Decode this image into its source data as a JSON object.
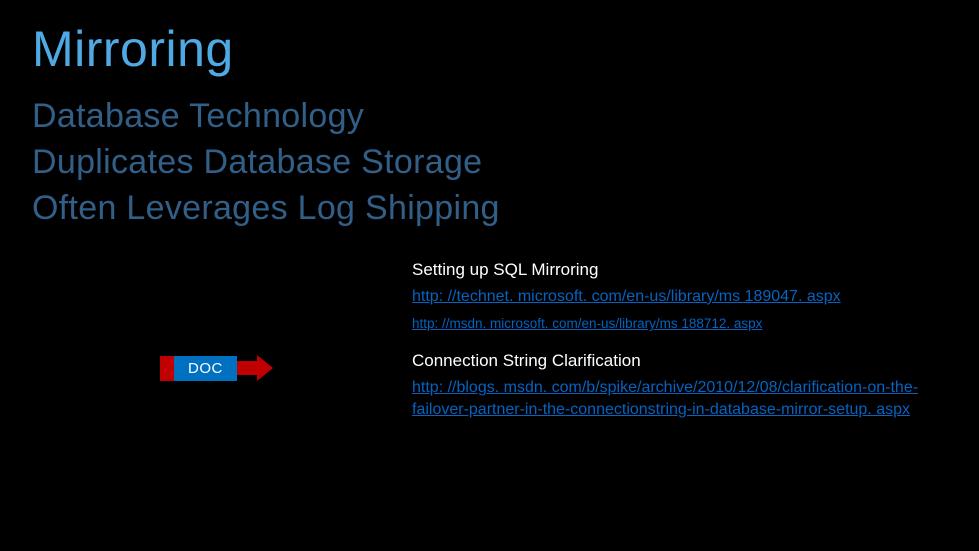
{
  "title": "Mirroring",
  "subtitles": {
    "line1": "Database Technology",
    "line2": "Duplicates Database Storage",
    "line3": "Often Leverages Log Shipping"
  },
  "doc_badge": {
    "label": "DOC"
  },
  "sections": {
    "section1": {
      "heading": "Setting up SQL Mirroring",
      "link1": "http: //technet. microsoft. com/en-us/library/ms 189047. aspx",
      "link2": "http: //msdn. microsoft. com/en-us/library/ms 188712. aspx"
    },
    "section2": {
      "heading": "Connection String Clarification",
      "link1": "http: //blogs. msdn. com/b/spike/archive/2010/12/08/clarification-on-the-failover-partner-in-the-connectionstring-in-database-mirror-setup. aspx"
    }
  }
}
